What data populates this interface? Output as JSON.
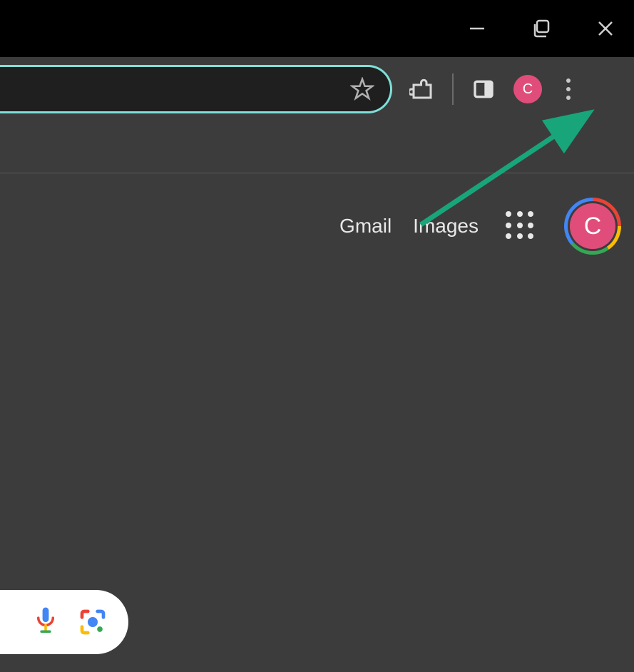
{
  "titlebar": {
    "minimize": "minimize",
    "maximize": "maximize",
    "close": "close"
  },
  "toolbar": {
    "bookmark": "star",
    "extensions": "extensions",
    "sidepanel": "sidepanel",
    "profile_letter": "C",
    "more": "more"
  },
  "page": {
    "gmail": "Gmail",
    "images": "Images",
    "apps": "google-apps",
    "profile_letter": "C"
  },
  "search": {
    "mic": "voice-search",
    "lens": "lens-search"
  },
  "annotation": {
    "arrow_target": "more-menu"
  }
}
